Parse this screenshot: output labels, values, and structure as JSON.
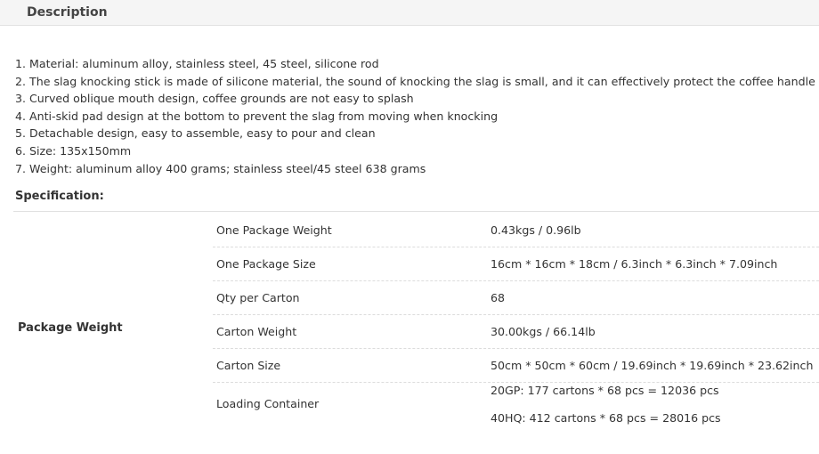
{
  "description": {
    "title": "Description",
    "items": [
      "1. Material: aluminum alloy, stainless steel, 45 steel, silicone rod",
      "2. The slag knocking stick is made of silicone material, the sound of knocking the slag is small, and it can effectively protect the coffee handle",
      "3. Curved oblique mouth design, coffee grounds are not easy to splash",
      "4. Anti-skid pad design at the bottom to prevent the slag from moving when knocking",
      "5. Detachable design, easy to assemble, easy to pour and clean",
      "6. Size: 135x150mm",
      "7. Weight: aluminum alloy 400 grams; stainless steel/45 steel 638 grams"
    ]
  },
  "specification": {
    "title": "Specification:",
    "group_label": "Package Weight",
    "rows": [
      {
        "name": "One Package Weight",
        "value": "0.43kgs / 0.96lb"
      },
      {
        "name": "One Package Size",
        "value": "16cm * 16cm * 18cm / 6.3inch * 6.3inch * 7.09inch"
      },
      {
        "name": "Qty per Carton",
        "value": "68"
      },
      {
        "name": "Carton Weight",
        "value": "30.00kgs / 66.14lb"
      },
      {
        "name": "Carton Size",
        "value": "50cm * 50cm * 60cm / 19.69inch * 19.69inch * 23.62inch"
      },
      {
        "name": "Loading Container",
        "values": [
          "20GP: 177 cartons * 68 pcs = 12036 pcs",
          "40HQ: 412 cartons * 68 pcs = 28016 pcs"
        ]
      }
    ]
  }
}
